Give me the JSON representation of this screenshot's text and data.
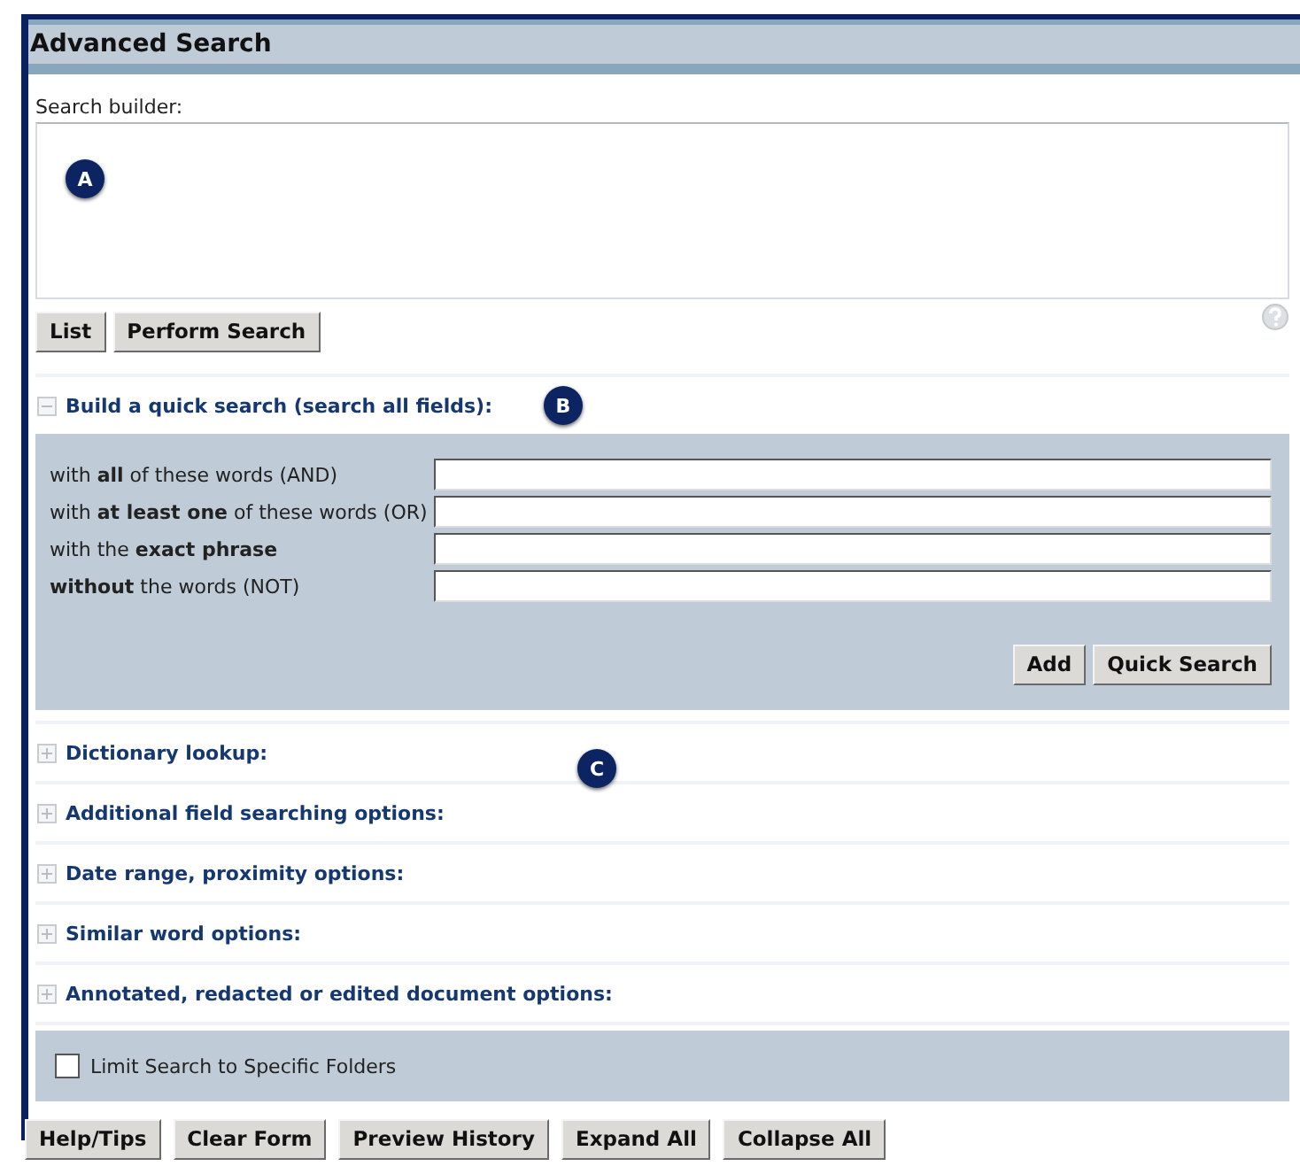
{
  "title": "Advanced Search",
  "builder": {
    "label": "Search builder:",
    "callout": "A"
  },
  "builder_buttons": [
    "List",
    "Perform Search"
  ],
  "sections": [
    {
      "title": "Build a quick search (search all fields):",
      "expanded": true,
      "callout": "B",
      "fields": [
        {
          "label": "with **all** of these words (AND)"
        },
        {
          "label": "with **at least one** of these words (OR)"
        },
        {
          "label": "with the **exact phrase**"
        },
        {
          "label": "**without** the words (NOT)"
        }
      ],
      "buttons": [
        "Add",
        "Quick Search"
      ]
    },
    {
      "title": "Dictionary lookup:",
      "expanded": false
    },
    {
      "title": "Additional field searching options:",
      "expanded": false
    },
    {
      "title": "Date range, proximity options:",
      "expanded": false
    },
    {
      "title": "Similar word options:",
      "expanded": false
    },
    {
      "title": "Annotated, redacted or edited document options:",
      "expanded": false
    }
  ],
  "section_callout": "C",
  "limit_folders": {
    "label": "Limit Search to Specific Folders",
    "checked": false
  },
  "footer_buttons": [
    "Help/Tips",
    "Clear Form",
    "Preview History",
    "Expand All",
    "Collapse All"
  ]
}
